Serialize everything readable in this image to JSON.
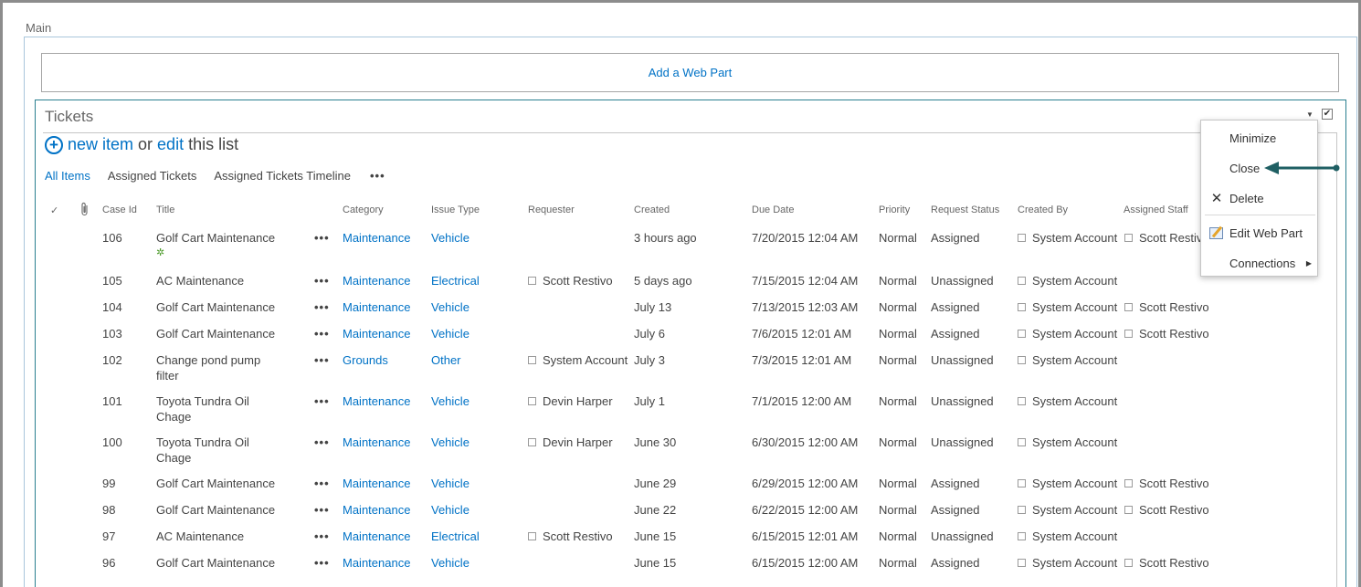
{
  "zone": {
    "label": "Main",
    "add_web_part": "Add a Web Part"
  },
  "webpart": {
    "title": "Tickets",
    "dropdown_arrow": "▼",
    "checkbox_mark": "✔"
  },
  "list_actions": {
    "plus": "+",
    "new_item": "new item",
    "or": "or",
    "edit": "edit",
    "this_list": "this list"
  },
  "views": {
    "items": [
      "All Items",
      "Assigned Tickets",
      "Assigned Tickets Timeline"
    ],
    "more": "•••",
    "active": "All Items"
  },
  "columns": {
    "check": "✓",
    "attachment_icon": "paperclip-icon",
    "case_id": "Case Id",
    "title": "Title",
    "category": "Category",
    "issue_type": "Issue Type",
    "requester": "Requester",
    "created": "Created",
    "due_date": "Due Date",
    "priority": "Priority",
    "request_status": "Request Status",
    "created_by": "Created By",
    "assigned_staff": "Assigned Staff"
  },
  "row_ellipsis": "•••",
  "new_badge": "✲",
  "rows": [
    {
      "id": "106",
      "title": "Golf Cart Maintenance",
      "new": true,
      "category": "Maintenance",
      "issue_type": "Vehicle",
      "requester": "",
      "created": "3 hours ago",
      "due": "7/20/2015 12:04 AM",
      "priority": "Normal",
      "status": "Assigned",
      "created_by": "System Account",
      "assigned": "Scott Restivo"
    },
    {
      "id": "105",
      "title": "AC Maintenance",
      "category": "Maintenance",
      "issue_type": "Electrical",
      "requester": "Scott Restivo",
      "created": "5 days ago",
      "due": "7/15/2015 12:04 AM",
      "priority": "Normal",
      "status": "Unassigned",
      "created_by": "System Account",
      "assigned": ""
    },
    {
      "id": "104",
      "title": "Golf Cart Maintenance",
      "category": "Maintenance",
      "issue_type": "Vehicle",
      "requester": "",
      "created": "July 13",
      "due": "7/13/2015 12:03 AM",
      "priority": "Normal",
      "status": "Assigned",
      "created_by": "System Account",
      "assigned": "Scott Restivo"
    },
    {
      "id": "103",
      "title": "Golf Cart Maintenance",
      "category": "Maintenance",
      "issue_type": "Vehicle",
      "requester": "",
      "created": "July 6",
      "due": "7/6/2015 12:01 AM",
      "priority": "Normal",
      "status": "Assigned",
      "created_by": "System Account",
      "assigned": "Scott Restivo"
    },
    {
      "id": "102",
      "title": "Change pond pump filter",
      "category": "Grounds",
      "issue_type": "Other",
      "requester": "System Account",
      "created": "July 3",
      "due": "7/3/2015 12:01 AM",
      "priority": "Normal",
      "status": "Unassigned",
      "created_by": "System Account",
      "assigned": ""
    },
    {
      "id": "101",
      "title": "Toyota Tundra Oil Chage",
      "category": "Maintenance",
      "issue_type": "Vehicle",
      "requester": "Devin Harper",
      "created": "July 1",
      "due": "7/1/2015 12:00 AM",
      "priority": "Normal",
      "status": "Unassigned",
      "created_by": "System Account",
      "assigned": ""
    },
    {
      "id": "100",
      "title": "Toyota Tundra Oil Chage",
      "category": "Maintenance",
      "issue_type": "Vehicle",
      "requester": "Devin Harper",
      "created": "June 30",
      "due": "6/30/2015 12:00 AM",
      "priority": "Normal",
      "status": "Unassigned",
      "created_by": "System Account",
      "assigned": ""
    },
    {
      "id": "99",
      "title": "Golf Cart Maintenance",
      "category": "Maintenance",
      "issue_type": "Vehicle",
      "requester": "",
      "created": "June 29",
      "due": "6/29/2015 12:00 AM",
      "priority": "Normal",
      "status": "Assigned",
      "created_by": "System Account",
      "assigned": "Scott Restivo"
    },
    {
      "id": "98",
      "title": "Golf Cart Maintenance",
      "category": "Maintenance",
      "issue_type": "Vehicle",
      "requester": "",
      "created": "June 22",
      "due": "6/22/2015 12:00 AM",
      "priority": "Normal",
      "status": "Assigned",
      "created_by": "System Account",
      "assigned": "Scott Restivo"
    },
    {
      "id": "97",
      "title": "AC Maintenance",
      "category": "Maintenance",
      "issue_type": "Electrical",
      "requester": "Scott Restivo",
      "created": "June 15",
      "due": "6/15/2015 12:01 AM",
      "priority": "Normal",
      "status": "Unassigned",
      "created_by": "System Account",
      "assigned": ""
    },
    {
      "id": "96",
      "title": "Golf Cart Maintenance",
      "category": "Maintenance",
      "issue_type": "Vehicle",
      "requester": "",
      "created": "June 15",
      "due": "6/15/2015 12:00 AM",
      "priority": "Normal",
      "status": "Assigned",
      "created_by": "System Account",
      "assigned": "Scott Restivo"
    }
  ],
  "context_menu": {
    "items": [
      {
        "label": "Minimize",
        "icon": ""
      },
      {
        "label": "Close",
        "icon": ""
      },
      {
        "label": "Delete",
        "icon": "close-x-icon",
        "glyph": "✕"
      },
      {
        "label": "Edit Web Part",
        "icon": "edit-web-part-icon"
      },
      {
        "label": "Connections",
        "icon": "",
        "submenu_glyph": "▶"
      }
    ]
  },
  "annotation": {
    "arrow_color": "#1f5f63"
  },
  "colors": {
    "link": "#0072c6",
    "text": "#444444",
    "webpart_border": "#2a7f8f",
    "new_badge": "#4c9a2a"
  }
}
